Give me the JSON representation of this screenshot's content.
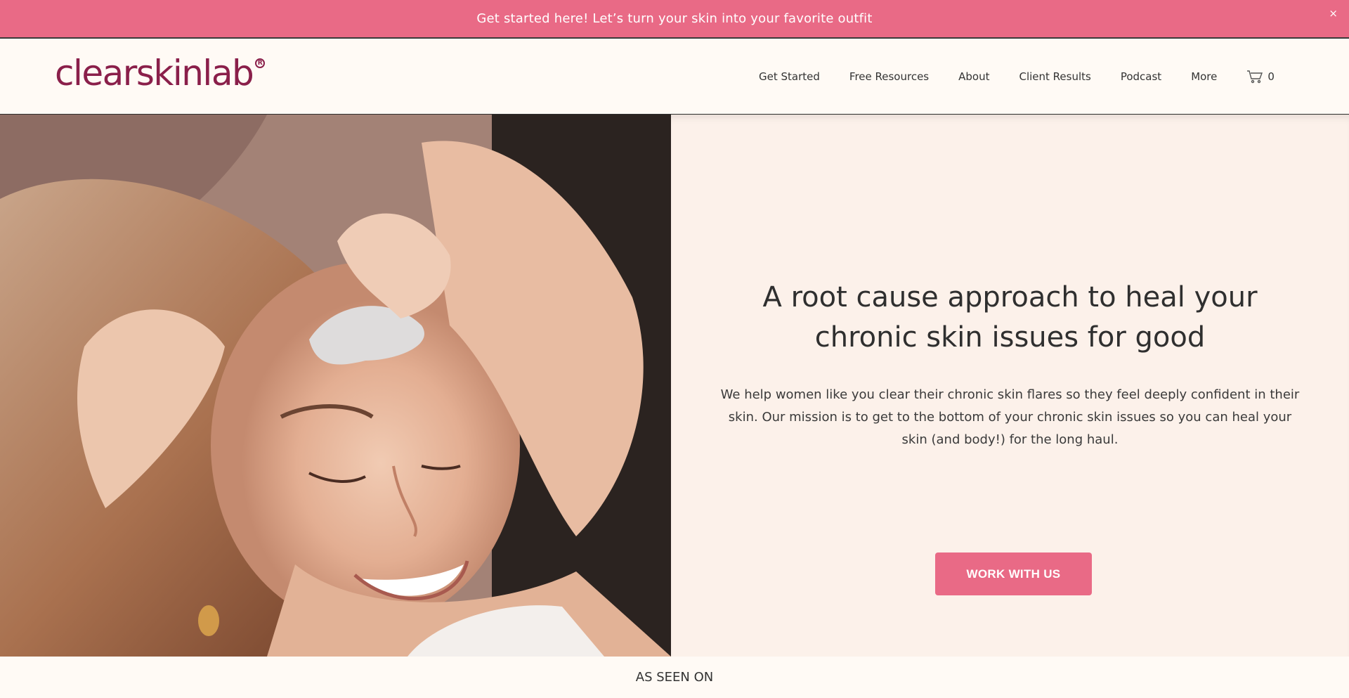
{
  "announcement": {
    "text": "Get started here! Let’s turn your skin into your favorite outfit",
    "close_label": "×"
  },
  "header": {
    "logo_text": "clearskinlab",
    "logo_mark": "R",
    "nav": [
      {
        "label": "Get Started"
      },
      {
        "label": "Free Resources"
      },
      {
        "label": "About"
      },
      {
        "label": "Client Results"
      },
      {
        "label": "Podcast"
      },
      {
        "label": "More"
      }
    ],
    "cart": {
      "icon": "cart-icon",
      "count": "0"
    }
  },
  "hero": {
    "image_alt": "Smiling woman using a gua sha stone on her forehead",
    "title": "A root cause approach to heal your chronic skin issues for good",
    "subtitle": "We help women like you clear their chronic skin flares so they feel deeply confident in their skin. Our mission is to get to the bottom of your chronic skin issues so you can heal your skin (and body!) for the long haul.",
    "cta_label": "WORK WITH US"
  },
  "as_seen_on": {
    "label": "AS SEEN ON"
  },
  "colors": {
    "brand_pink": "#e96a86",
    "brand_maroon": "#8a1f4a",
    "background": "#fffaf5",
    "panel": "#fcf1ea"
  }
}
